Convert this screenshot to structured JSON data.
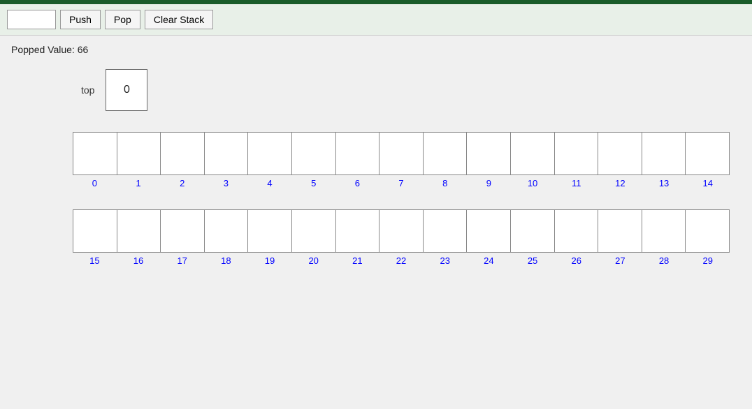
{
  "topbar": {
    "color": "#1a5c2a"
  },
  "toolbar": {
    "input_placeholder": "",
    "input_value": "",
    "push_label": "Push",
    "pop_label": "Pop",
    "clear_label": "Clear Stack"
  },
  "main": {
    "popped_value_label": "Popped Value: 66",
    "top_label": "top",
    "top_value": "0"
  },
  "row1": {
    "indices": [
      "0",
      "1",
      "2",
      "3",
      "4",
      "5",
      "6",
      "7",
      "8",
      "9",
      "10",
      "11",
      "12",
      "13",
      "14"
    ],
    "values": [
      "",
      "",
      "",
      "",
      "",
      "",
      "",
      "",
      "",
      "",
      "",
      "",
      "",
      "",
      ""
    ]
  },
  "row2": {
    "indices": [
      "15",
      "16",
      "17",
      "18",
      "19",
      "20",
      "21",
      "22",
      "23",
      "24",
      "25",
      "26",
      "27",
      "28",
      "29"
    ],
    "values": [
      "",
      "",
      "",
      "",
      "",
      "",
      "",
      "",
      "",
      "",
      "",
      "",
      "",
      "",
      ""
    ]
  }
}
